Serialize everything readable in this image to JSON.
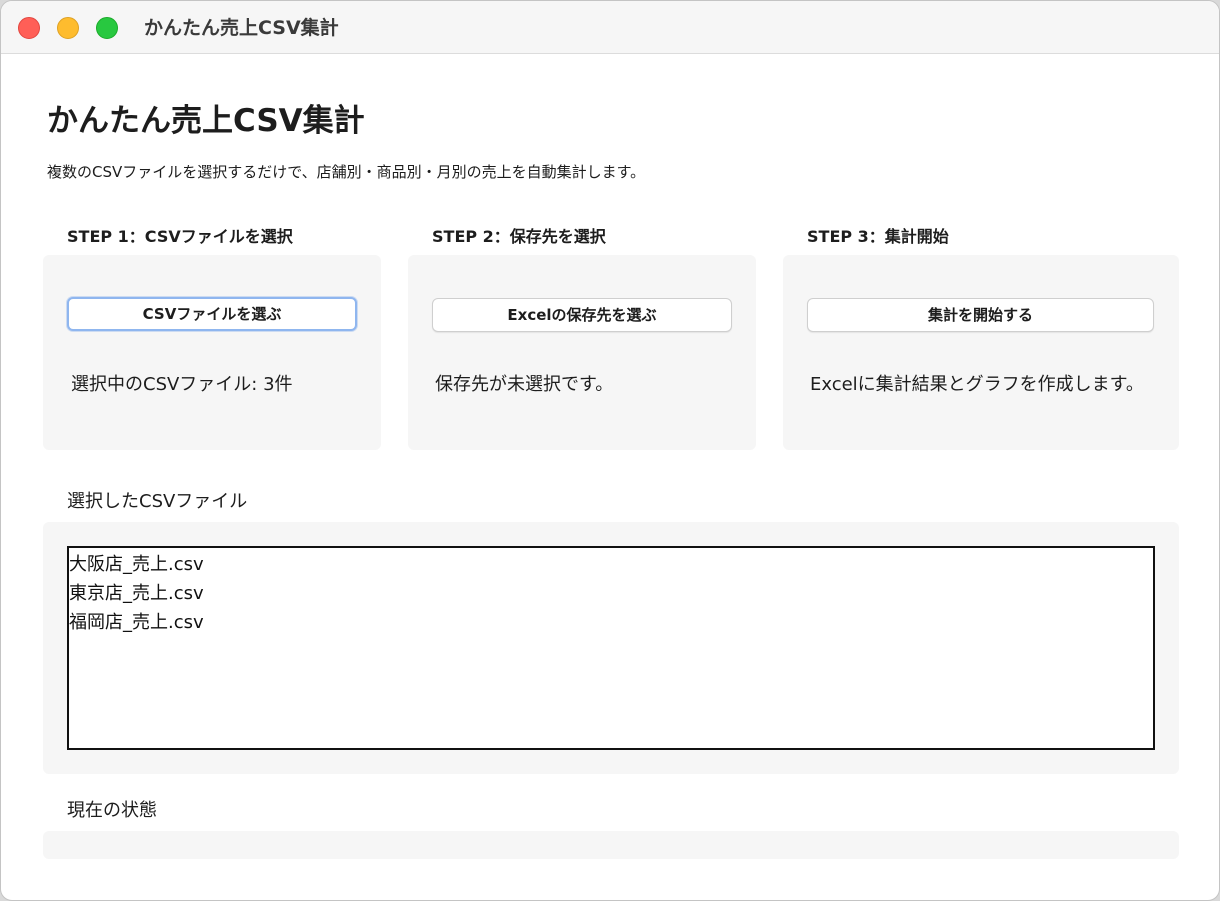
{
  "window": {
    "title": "かんたん売上CSV集計"
  },
  "header": {
    "title": "かんたん売上CSV集計",
    "description": "複数のCSVファイルを選択するだけで、店舗別・商品別・月別の売上を自動集計します。"
  },
  "steps": [
    {
      "label": "STEP 1：CSVファイルを選択",
      "button": "CSVファイルを選ぶ",
      "status": "選択中のCSVファイル: 3件"
    },
    {
      "label": "STEP 2：保存先を選択",
      "button": "Excelの保存先を選ぶ",
      "status": "保存先が未選択です。"
    },
    {
      "label": "STEP 3：集計開始",
      "button": "集計を開始する",
      "status": "Excelに集計結果とグラフを作成します。"
    }
  ],
  "file_list": {
    "label": "選択したCSVファイル",
    "items": [
      "大阪店_売上.csv",
      "東京店_売上.csv",
      "福岡店_売上.csv"
    ]
  },
  "status_section": {
    "label": "現在の状態",
    "text": ""
  },
  "colors": {
    "close": "#ff5f57",
    "minimize": "#febc2e",
    "maximize": "#28c840",
    "card_background": "#f6f6f6",
    "focus_ring": "#8fb6ef"
  }
}
